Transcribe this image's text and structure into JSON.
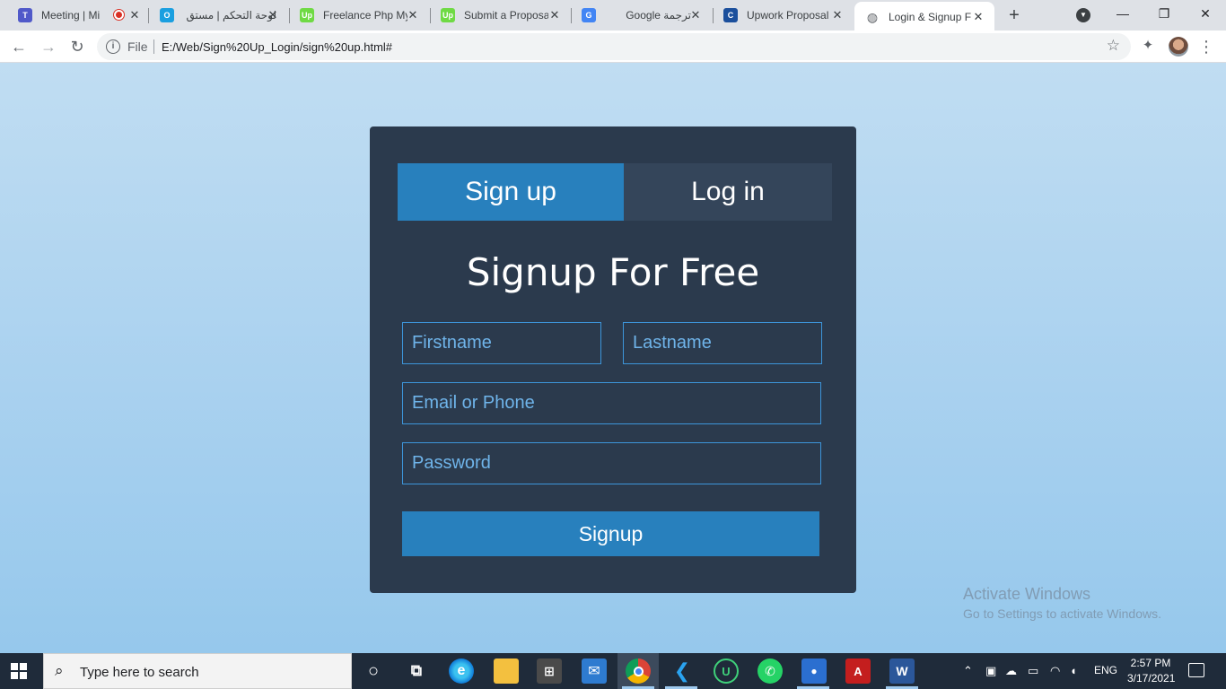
{
  "browser": {
    "tabs": [
      {
        "title": "Meeting | Mi",
        "icon": "teams-icon",
        "color": "#5059c9",
        "glyph": "T"
      },
      {
        "title": "لوحة التحكم | مستق",
        "icon": "dashboard-icon",
        "color": "#1a9fe0",
        "glyph": "O"
      },
      {
        "title": "Freelance Php My",
        "icon": "upwork-icon",
        "color": "#6fda44",
        "glyph": "Up"
      },
      {
        "title": "Submit a Proposa",
        "icon": "upwork-icon",
        "color": "#6fda44",
        "glyph": "Up"
      },
      {
        "title": "Google ترجمة",
        "icon": "google-translate-icon",
        "color": "#4285f4",
        "glyph": "G"
      },
      {
        "title": "Upwork Proposal",
        "icon": "upwork-proposal-icon",
        "color": "#1b4f9c",
        "glyph": "C"
      },
      {
        "title": "Login & Signup F",
        "icon": "globe-icon",
        "color": "#5f6368",
        "glyph": "◍"
      }
    ],
    "new_tab": "+",
    "window_controls": {
      "minimize": "—",
      "restore": "❐",
      "close": "✕"
    },
    "address": {
      "scheme_label": "File",
      "url": "E:/Web/Sign%20Up_Login/sign%20up.html#"
    }
  },
  "page": {
    "tabs": {
      "signup": "Sign up",
      "login": "Log in"
    },
    "title": "Signup For Free",
    "fields": {
      "firstname": "Firstname",
      "lastname": "Lastname",
      "email": "Email or Phone",
      "password": "Password"
    },
    "submit": "Signup",
    "colors": {
      "card": "#2b3a4d",
      "accent": "#2880bd",
      "field_border": "#3d95da"
    }
  },
  "watermark": {
    "line1": "Activate Windows",
    "line2": "Go to Settings to activate Windows."
  },
  "taskbar": {
    "search_placeholder": "Type here to search",
    "language": "ENG",
    "time": "2:57 PM",
    "date": "3/17/2021"
  }
}
